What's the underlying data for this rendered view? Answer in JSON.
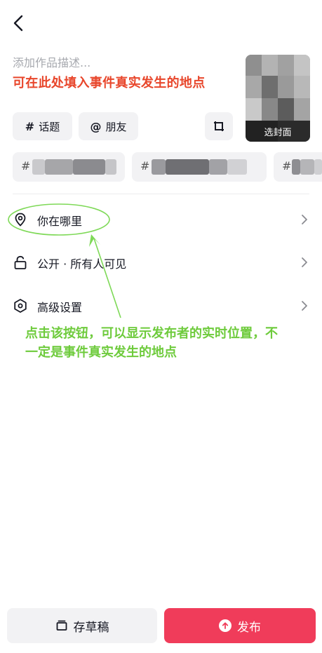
{
  "header": {
    "back_icon": "chevron-left-icon"
  },
  "description": {
    "placeholder": "添加作品描述...",
    "annotation": "可在此处填入事件真实发生的地点"
  },
  "cover": {
    "button_label": "选封面"
  },
  "chips": {
    "topic": {
      "symbol": "#",
      "label": "话题"
    },
    "friend": {
      "symbol": "@",
      "label": "朋友"
    },
    "crop_icon": "crop-icon"
  },
  "suggestions": [
    {
      "symbol": "#"
    },
    {
      "symbol": "#"
    },
    {
      "symbol": "#"
    }
  ],
  "settings": {
    "location": {
      "label": "你在哪里",
      "icon": "location-pin-icon"
    },
    "privacy": {
      "label": "公开 · 所有人可见",
      "icon": "unlock-icon"
    },
    "advanced": {
      "label": "高级设置",
      "icon": "hexagon-settings-icon"
    }
  },
  "annotation_green": "点击该按钮，可以显示发布者的实时位置，不一定是事件真实发生的地点",
  "footer": {
    "draft_label": "存草稿",
    "publish_label": "发布"
  },
  "colors": {
    "annotation_red": "#e8462b",
    "annotation_green": "#6ecb3c",
    "publish": "#f03c5a"
  }
}
